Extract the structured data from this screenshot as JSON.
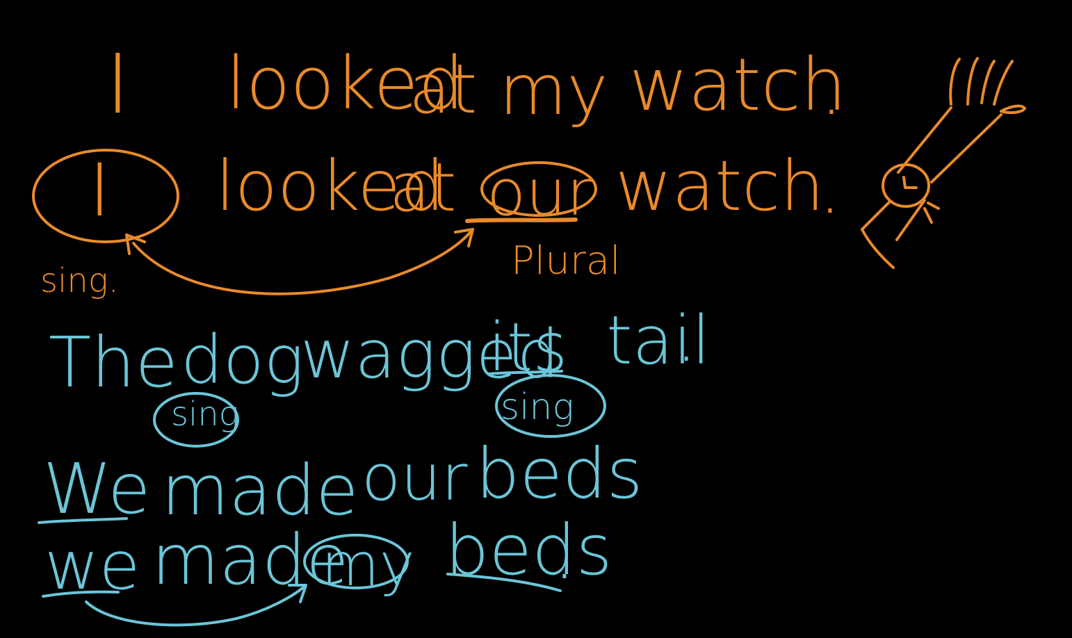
{
  "colors": {
    "background": "#000000",
    "orange": "#e98a2a",
    "blue": "#6cc5d8"
  },
  "orange_section": {
    "line1": {
      "w1": "I",
      "w2": "looked",
      "w3": "at",
      "w4": "my",
      "w5": "watch",
      "dot": "."
    },
    "line2": {
      "w1": "I",
      "w2": "looked",
      "w3": "at",
      "w4": "our",
      "w5": "watch",
      "dot": "."
    },
    "label_sing": "sing.",
    "label_plural": "Plural"
  },
  "blue_section": {
    "line3": {
      "w1": "The",
      "w2": "dog",
      "w3": "wagged",
      "w4": "its",
      "w5": "tail",
      "dot": "."
    },
    "sing_label_left": "sing",
    "sing_label_right": "sing",
    "line4": {
      "w1": "We",
      "w2": "made",
      "w3": "our",
      "w4": "beds"
    },
    "line5": {
      "w1": "we",
      "w2": "made",
      "w3": "my",
      "w4": "beds",
      "dot": "."
    }
  }
}
